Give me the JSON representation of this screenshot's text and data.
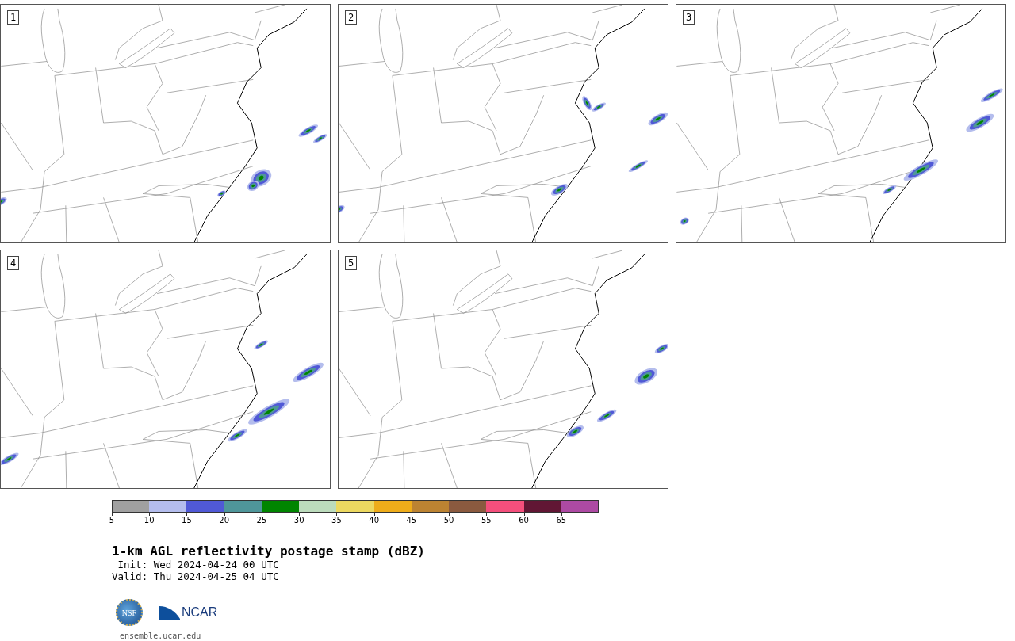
{
  "panels": [
    {
      "label": "1"
    },
    {
      "label": "2"
    },
    {
      "label": "3"
    },
    {
      "label": "4"
    },
    {
      "label": "5"
    }
  ],
  "colorbar": {
    "bins": [
      {
        "color": "#a0a0a0",
        "tick": "5"
      },
      {
        "color": "#b4bded",
        "tick": "10"
      },
      {
        "color": "#5059d6",
        "tick": "15"
      },
      {
        "color": "#4f969a",
        "tick": "20"
      },
      {
        "color": "#008500",
        "tick": "25"
      },
      {
        "color": "#bcdbbc",
        "tick": "30"
      },
      {
        "color": "#ecd860",
        "tick": "35"
      },
      {
        "color": "#eeac1a",
        "tick": "40"
      },
      {
        "color": "#bc8332",
        "tick": "45"
      },
      {
        "color": "#8b5a3f",
        "tick": "50"
      },
      {
        "color": "#f44f7c",
        "tick": "55"
      },
      {
        "color": "#611634",
        "tick": "60"
      },
      {
        "color": "#ad4aa3",
        "tick": "65"
      }
    ]
  },
  "title": "1-km AGL reflectivity postage stamp (dBZ)",
  "init": " Init: Wed 2024-04-24 00 UTC",
  "valid": "Valid: Thu 2024-04-25 04 UTC",
  "logo": {
    "nsf_text": "NSF",
    "ncar_text": "NCAR"
  },
  "url": "ensemble.ucar.edu"
}
